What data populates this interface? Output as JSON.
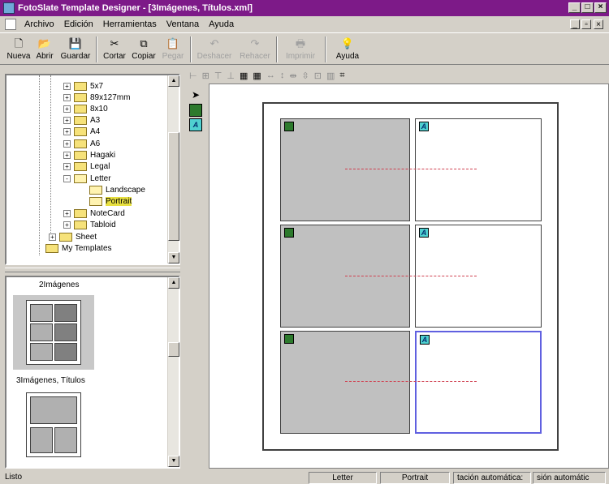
{
  "window": {
    "title": "FotoSlate Template Designer - [3Imágenes, Títulos.xml]",
    "title_bar_color": "#7d1a88"
  },
  "menu": [
    "Archivo",
    "Edición",
    "Herramientas",
    "Ventana",
    "Ayuda"
  ],
  "toolbar": {
    "buttons": [
      {
        "label": "Nueva",
        "icon": "new-file-icon",
        "enabled": true
      },
      {
        "label": "Abrir",
        "icon": "open-folder-icon",
        "enabled": true
      },
      {
        "label": "Guardar",
        "icon": "save-disk-icon",
        "enabled": true
      },
      {
        "label": "Cortar",
        "icon": "scissors-icon",
        "enabled": true
      },
      {
        "label": "Copiar",
        "icon": "copy-icon",
        "enabled": true
      },
      {
        "label": "Pegar",
        "icon": "paste-icon",
        "enabled": false
      },
      {
        "label": "Deshacer",
        "icon": "undo-icon",
        "enabled": false
      },
      {
        "label": "Rehacer",
        "icon": "redo-icon",
        "enabled": false
      },
      {
        "label": "Imprimir",
        "icon": "printer-icon",
        "enabled": false
      },
      {
        "label": "Ayuda",
        "icon": "help-bulb-icon",
        "enabled": true
      }
    ]
  },
  "tree": {
    "items": [
      {
        "label": "5x7",
        "expander": "+"
      },
      {
        "label": "89x127mm",
        "expander": "+"
      },
      {
        "label": "8x10",
        "expander": "+"
      },
      {
        "label": "A3",
        "expander": "+"
      },
      {
        "label": "A4",
        "expander": "+"
      },
      {
        "label": "A6",
        "expander": "+"
      },
      {
        "label": "Hagaki",
        "expander": "+"
      },
      {
        "label": "Legal",
        "expander": "+"
      },
      {
        "label": "Letter",
        "expander": "-"
      },
      {
        "label": "Landscape",
        "expander": ""
      },
      {
        "label": "Portrait",
        "expander": "",
        "selected": true
      },
      {
        "label": "NoteCard",
        "expander": "+"
      },
      {
        "label": "Tabloid",
        "expander": "+"
      },
      {
        "label": "Sheet",
        "expander": "+"
      },
      {
        "label": "My Templates",
        "expander": ""
      }
    ]
  },
  "thumbnails": {
    "top_label": "2Imágenes",
    "selected_label": "3Imágenes, Títulos"
  },
  "tools": [
    "pointer-arrow-icon",
    "image-placeholder-icon",
    "text-placeholder-icon"
  ],
  "text_icon_glyph": "A",
  "status": {
    "left": "Listo",
    "paper": "Letter",
    "orientation": "Portrait",
    "field3": "tación automática:",
    "field4": "sión automátic"
  }
}
